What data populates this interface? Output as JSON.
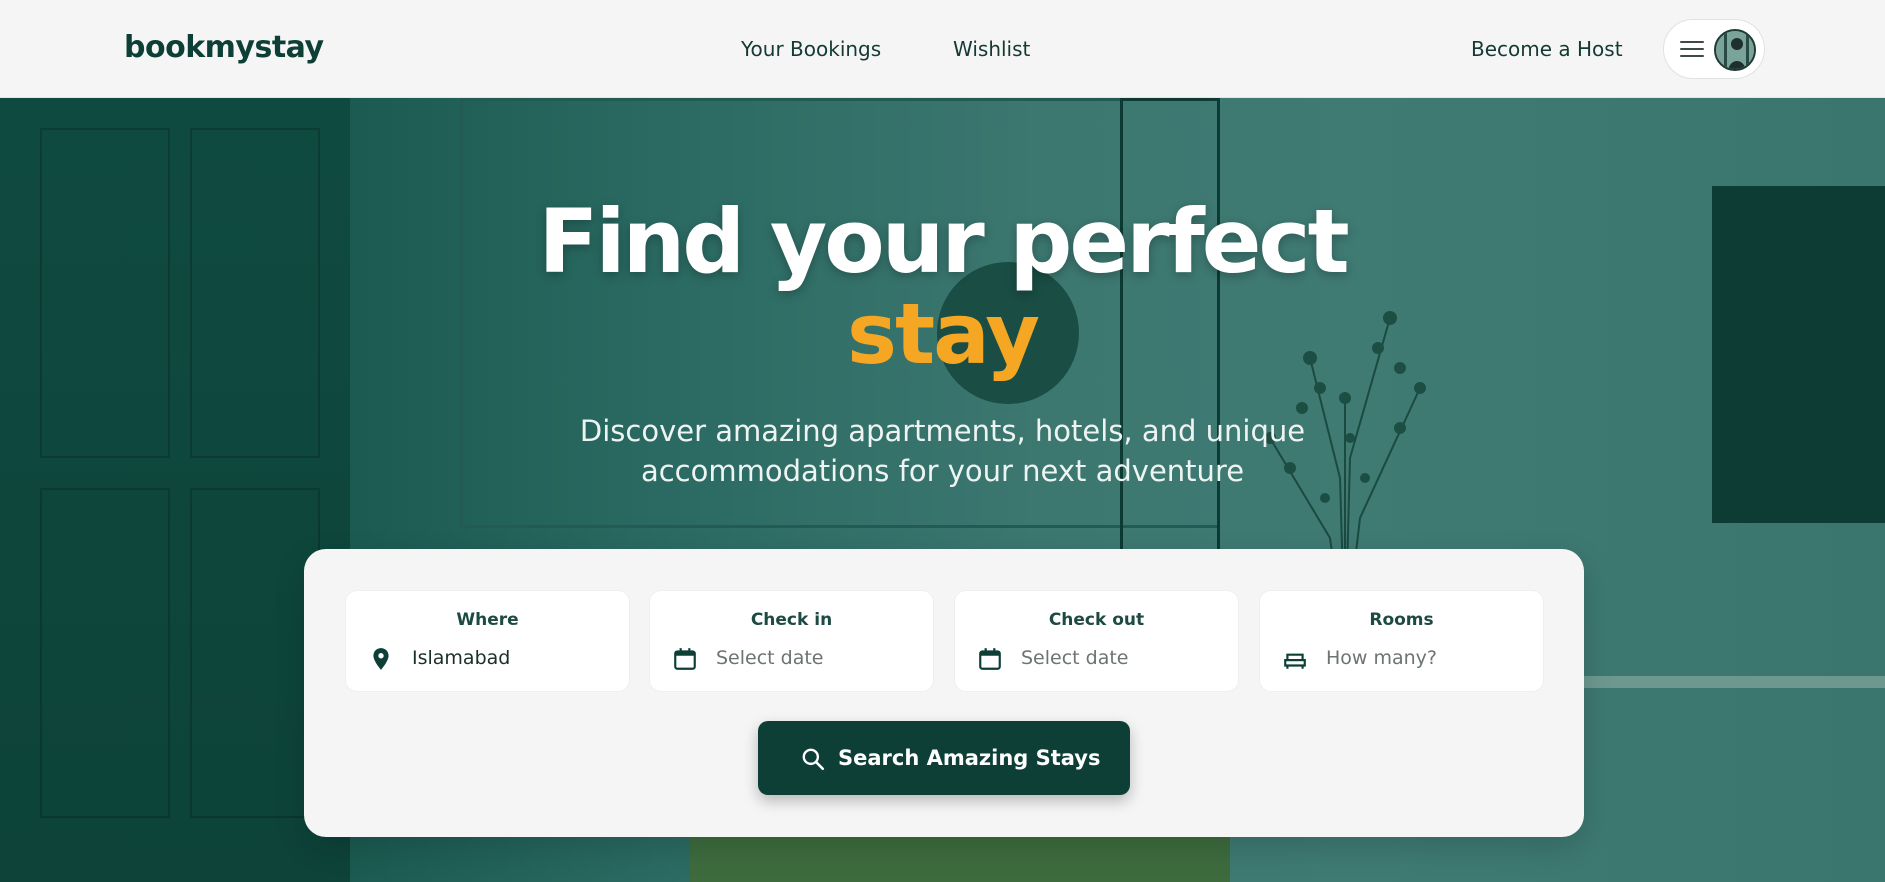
{
  "header": {
    "logo": "bookmystay",
    "nav": {
      "bookings": "Your Bookings",
      "wishlist": "Wishlist",
      "host": "Become a Host"
    }
  },
  "hero": {
    "title": "Find your perfect",
    "accent": "stay",
    "subtitle_line1": "Discover amazing apartments, hotels, and unique",
    "subtitle_line2": "accommodations for your next adventure"
  },
  "search": {
    "where": {
      "label": "Where",
      "value": "Islamabad",
      "icon": "location-pin-icon"
    },
    "checkin": {
      "label": "Check in",
      "placeholder": "Select date",
      "icon": "calendar-icon"
    },
    "checkout": {
      "label": "Check out",
      "placeholder": "Select date",
      "icon": "calendar-icon"
    },
    "rooms": {
      "label": "Rooms",
      "placeholder": "How many?",
      "icon": "bed-icon"
    },
    "button": "Search Amazing Stays"
  },
  "colors": {
    "brand": "#0e3f37",
    "accent": "#f5a623",
    "background": "#f4f5f4"
  }
}
